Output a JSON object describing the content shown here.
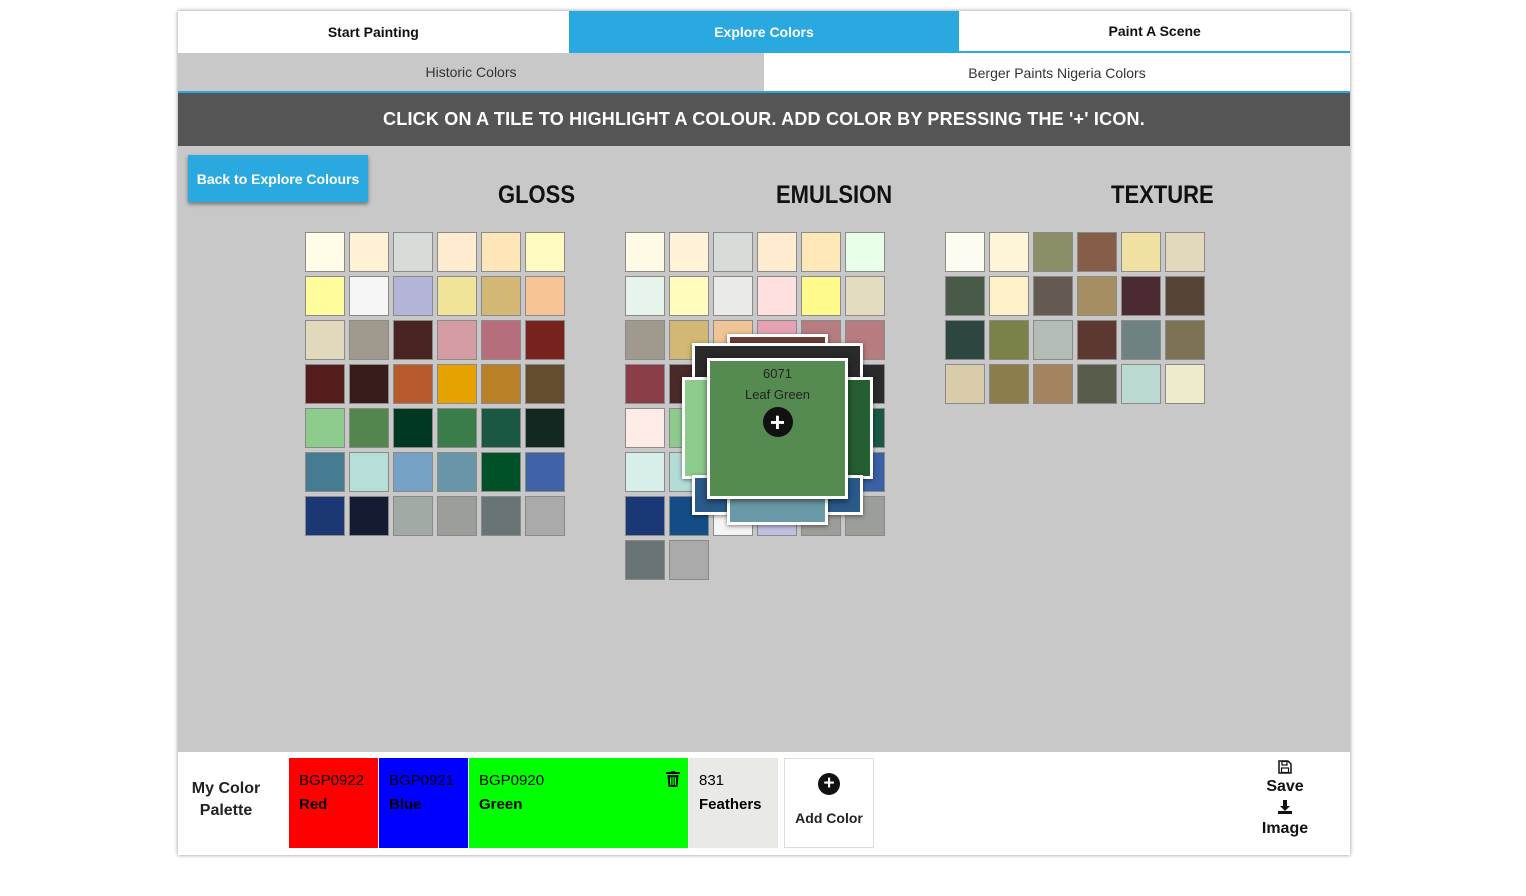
{
  "tabs": [
    "Start Painting",
    "Explore Colors",
    "Paint A Scene"
  ],
  "subtabs": [
    "Historic Colors",
    "Berger Paints Nigeria Colors"
  ],
  "banner": "CLICK ON A TILE TO HIGHLIGHT A COLOUR. ADD COLOR BY PRESSING THE '+' ICON.",
  "back_button": "Back to Explore Colours",
  "sections": {
    "gloss": {
      "title": "GLOSS",
      "colors": [
        "#fffce8",
        "#fff2d4",
        "#d8dcd8",
        "#ffecd0",
        "#ffe6b8",
        "#fffac0",
        "#fffc9c",
        "#f6f6f6",
        "#b4b4d8",
        "#f0e498",
        "#d2b874",
        "#f7c496",
        "#e2d9bc",
        "#a09a8e",
        "#4a2422",
        "#d69ca4",
        "#b66e7c",
        "#78221e",
        "#541c1c",
        "#381c1c",
        "#b85a2c",
        "#e6a200",
        "#ba8028",
        "#644c2e",
        "#8ecc8e",
        "#52864e",
        "#003822",
        "#3a7c4a",
        "#1a5844",
        "#142822",
        "#467c92",
        "#b8deda",
        "#76a2c6",
        "#6896a8",
        "#005028",
        "#4062a8",
        "#1c3874",
        "#141c34",
        "#a2aaa6",
        "#9c9e9a",
        "#687476",
        "#aaaaaa"
      ]
    },
    "emulsion": {
      "title": "EMULSION",
      "colors": [
        "#fffae6",
        "#fff2d6",
        "#d8dcd8",
        "#ffecd0",
        "#ffe8b8",
        "#e6ffe6",
        "#e6f4ec",
        "#fffcbc",
        "#eaeae8",
        "#ffe0e0",
        "#fffa8a",
        "#e2dcc0",
        "#a09a8e",
        "#d2b874",
        "#f0c494",
        "#e6a2b2",
        "#b67c80",
        "#b67c80",
        "#8a3e48",
        "#4a2a28",
        "#d29060",
        "#e0a800",
        "#6a4c30",
        "#2a2a2a",
        "#ffece6",
        "#8ecc8e",
        "#558a50",
        "#3a7c4a",
        "#1a5844",
        "#1a5844",
        "#d8eeea",
        "#b4dcd6",
        "#76a0c6",
        "#6896a8",
        "#005028",
        "#3c60a6",
        "#1a3876",
        "#144c86",
        "#f4f4f4",
        "#c0c0e0",
        "#9c9e9a",
        "#9c9e9a",
        "#687476",
        "#aaaaaa"
      ]
    },
    "texture": {
      "title": "TEXTURE",
      "colors": [
        "#fdfcf0",
        "#fef4d8",
        "#8c8e68",
        "#865e48",
        "#f0e0a2",
        "#e2d8bc",
        "#4a5a48",
        "#fef0c8",
        "#645a52",
        "#a48e62",
        "#4c2a32",
        "#564436",
        "#2e4640",
        "#7a8248",
        "#b4bcb6",
        "#5c3830",
        "#6e8282",
        "#7e7254",
        "#d8ccaa",
        "#8c7e4c",
        "#a48460",
        "#585c4a",
        "#bcdad4",
        "#eeeacc"
      ]
    }
  },
  "popup": {
    "code": "6071",
    "name": "Leaf Green",
    "color": "#558a50",
    "add_icon": "plus-circle-icon",
    "stack_colors": [
      "#6a3c36",
      "#2a2a2a",
      "#8ecc8e",
      "#255e30",
      "#2a5a8a",
      "#6a9aa8",
      "#6a3c36"
    ]
  },
  "palette": {
    "label_line1": "My Color",
    "label_line2": "Palette",
    "swatches": [
      {
        "code": "BGP0922",
        "name": "Red",
        "color": "#ff0000"
      },
      {
        "code": "BGP0921",
        "name": "Blue",
        "color": "#0000ff"
      },
      {
        "code": "BGP0920",
        "name": "Green",
        "color": "#00ff00"
      },
      {
        "code": "831",
        "name": "Feathers",
        "color": "#e9e9e6"
      }
    ],
    "add_color": "Add Color",
    "save": "Save",
    "image": "Image",
    "save_icon": "floppy-disk-icon",
    "image_icon": "download-icon",
    "trash_icon": "trash-icon"
  }
}
